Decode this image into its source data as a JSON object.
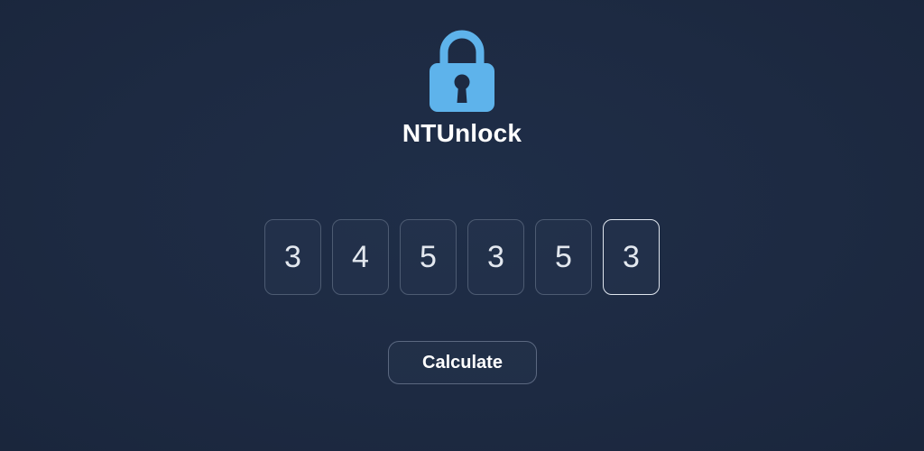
{
  "app": {
    "title": "NTUnlock",
    "logo_icon": "padlock-icon",
    "accent_color": "#5eb3eb"
  },
  "pin": {
    "digits": [
      "3",
      "4",
      "5",
      "3",
      "5",
      "3"
    ],
    "active_index": 5
  },
  "actions": {
    "calculate_label": "Calculate"
  }
}
